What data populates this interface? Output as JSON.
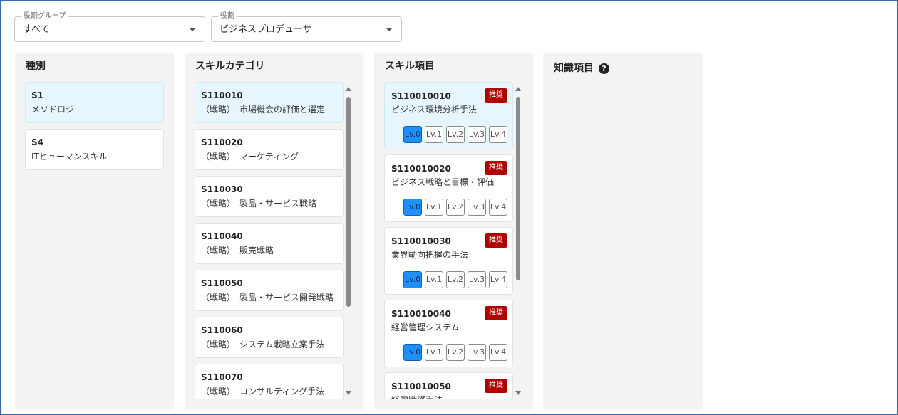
{
  "filters": {
    "role_group": {
      "label": "役割グループ",
      "value": "すべて"
    },
    "role": {
      "label": "役割",
      "value": "ビジネスプロデューサ"
    }
  },
  "type_panel": {
    "title": "種別",
    "items": [
      {
        "code": "S1",
        "name": "メソドロジ",
        "selected": true
      },
      {
        "code": "S4",
        "name": "ITヒューマンスキル",
        "selected": false
      }
    ]
  },
  "category_panel": {
    "title": "スキルカテゴリ",
    "items": [
      {
        "code": "S110010",
        "name": "（戦略）　市場機会の評価と選定"
      },
      {
        "code": "S110020",
        "name": "（戦略）　マーケティング"
      },
      {
        "code": "S110030",
        "name": "（戦略）　製品・サービス戦略"
      },
      {
        "code": "S110040",
        "name": "（戦略）　販売戦略"
      },
      {
        "code": "S110050",
        "name": "（戦略）　製品・サービス開発戦略"
      },
      {
        "code": "S110060",
        "name": "（戦略）　システム戦略立案手法"
      },
      {
        "code": "S110070",
        "name": "（戦略）　コンサルティング手法"
      }
    ]
  },
  "skill_panel": {
    "title": "スキル項目",
    "badge": "推奨",
    "levels": [
      "Lv.0",
      "Lv.1",
      "Lv.2",
      "Lv.3",
      "Lv.4"
    ],
    "items": [
      {
        "code": "S110010010",
        "name": "ビジネス環境分析手法"
      },
      {
        "code": "S110010020",
        "name": "ビジネス戦略と目標・評価"
      },
      {
        "code": "S110010030",
        "name": "業界動向把握の手法"
      },
      {
        "code": "S110010040",
        "name": "経営管理システム"
      },
      {
        "code": "S110010050",
        "name": "経営戦略手法"
      }
    ]
  },
  "knowledge_panel": {
    "title": "知識項目",
    "help_icon": "question-circle-icon"
  },
  "colors": {
    "selected_bg": "#e7f6fc",
    "badge": "#b00000",
    "level_selected": "#1e90ff",
    "panel_bg": "#f3f3f3"
  }
}
